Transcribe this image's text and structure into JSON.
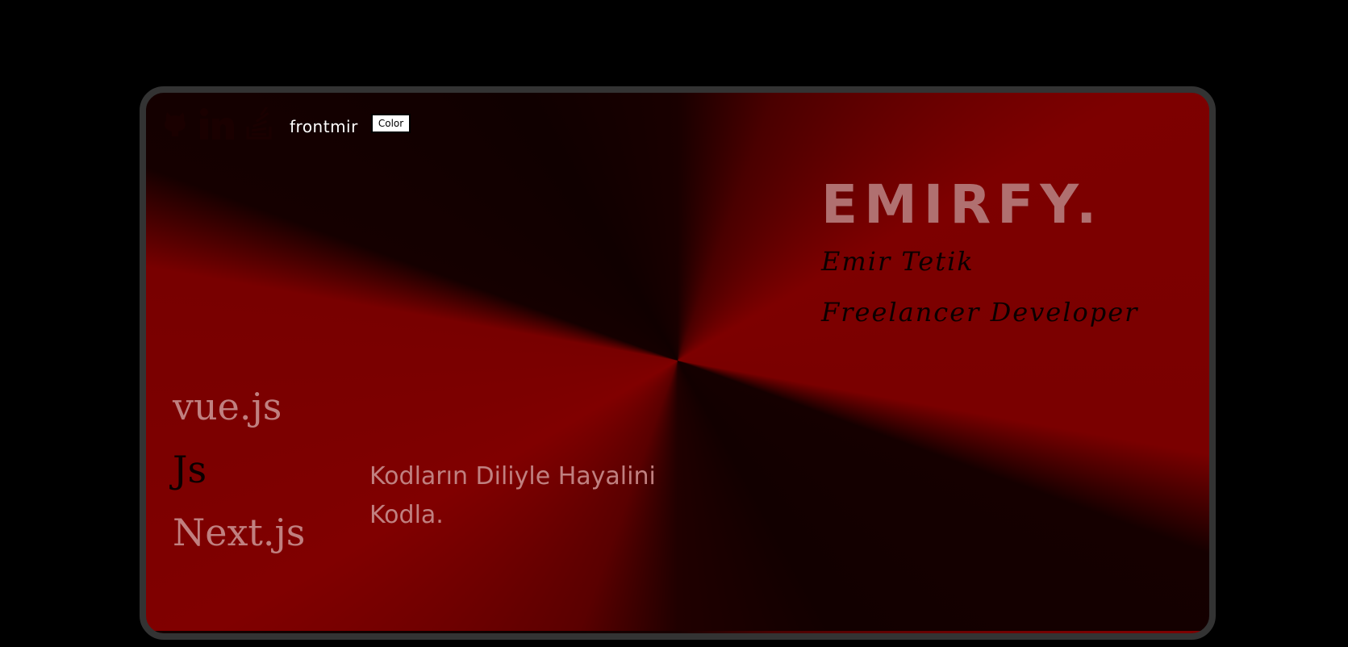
{
  "nav": {
    "brand": "frontmir",
    "color_button": "Color",
    "icons": [
      "github-icon",
      "linkedin-icon",
      "stackoverflow-icon"
    ]
  },
  "hero": {
    "title": "EMIRFY.",
    "name": "Emir Tetik",
    "role": "Freelancer Developer"
  },
  "tech": [
    "vue.js",
    "Js",
    "Next.js"
  ],
  "tagline": "Kodların Diliyle Hayalini Kodla.",
  "colors": {
    "background": "#000000",
    "frame": "#333333",
    "accent_red": "#800000",
    "title_pink": "#b07070"
  }
}
